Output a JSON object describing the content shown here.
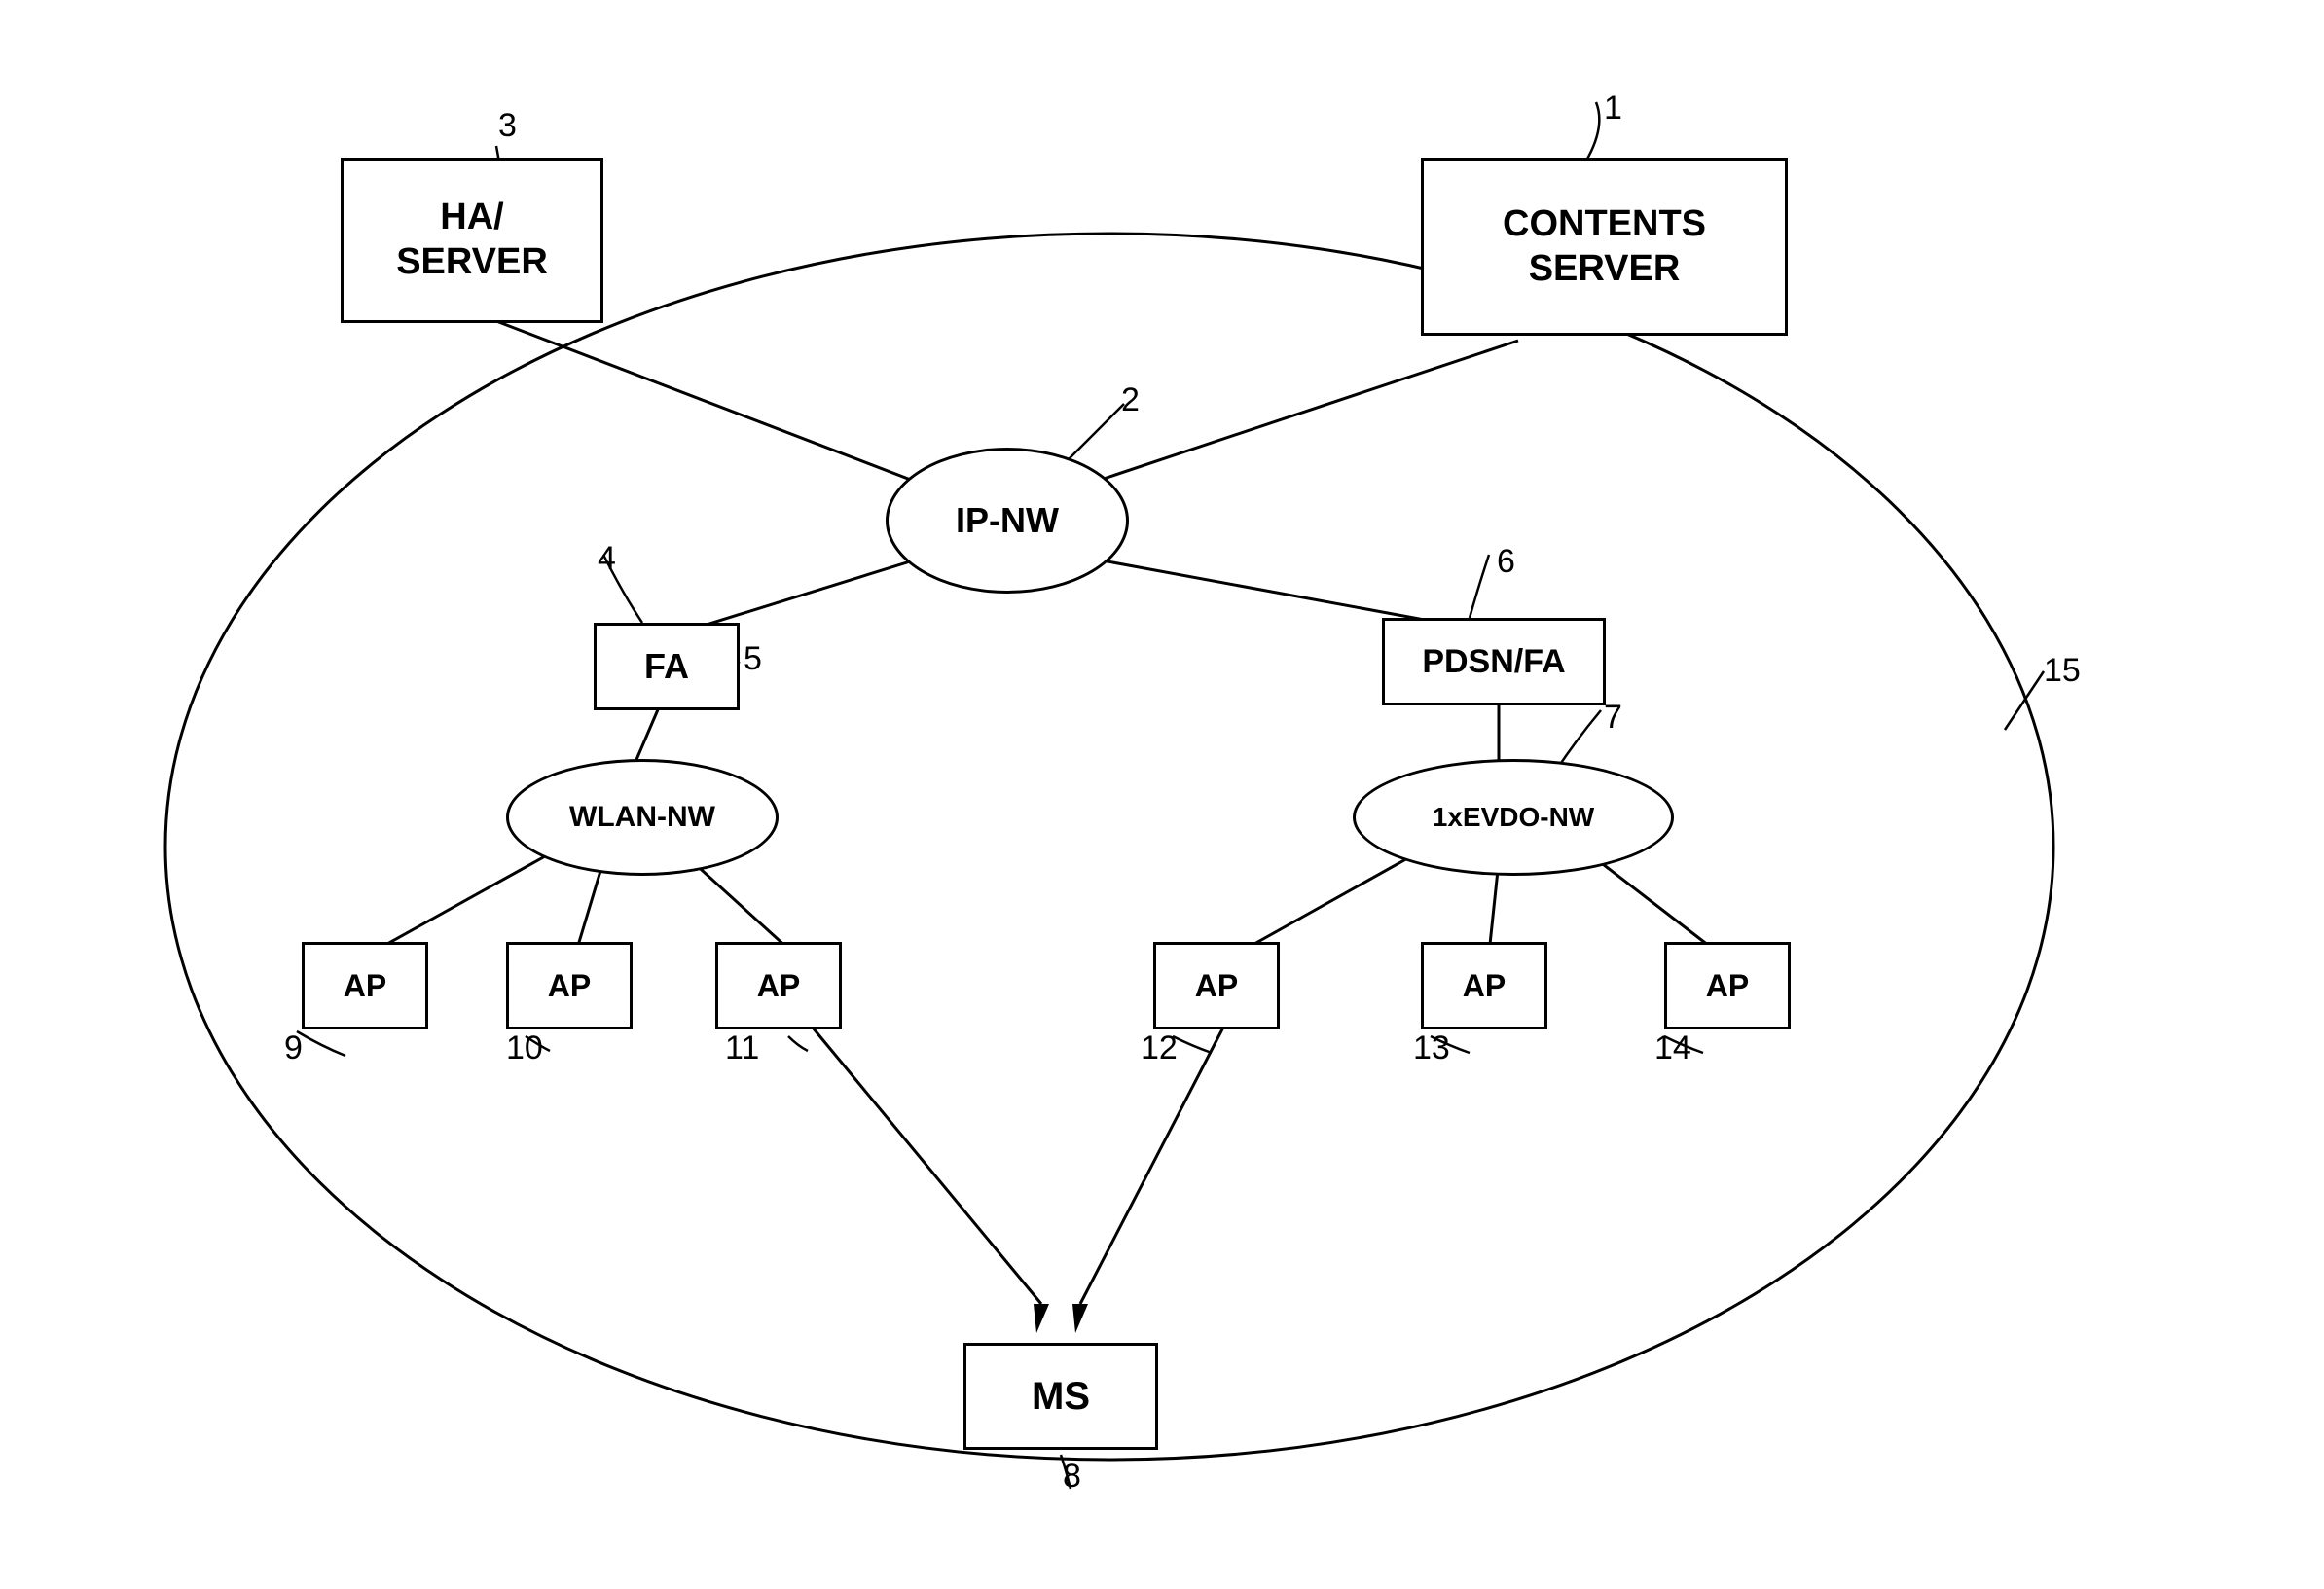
{
  "nodes": {
    "contents_server": {
      "label": "CONTENTS\nSERVER",
      "ref": "1"
    },
    "ip_nw": {
      "label": "IP-NW",
      "ref": "2"
    },
    "ha_server": {
      "label": "HA/\nSERVER",
      "ref": "3"
    },
    "fa": {
      "label": "FA",
      "ref": "4"
    },
    "ref5": {
      "label": "5"
    },
    "pdsn_fa": {
      "label": "PDSN/FA",
      "ref": "6"
    },
    "evdo_nw": {
      "label": "1xEVDO-NW",
      "ref": "7"
    },
    "ms": {
      "label": "MS",
      "ref": "8"
    },
    "wlan_nw": {
      "label": "WLAN-NW",
      "ref": ""
    },
    "ap_wlan_1": {
      "label": "AP",
      "ref": "9"
    },
    "ap_wlan_2": {
      "label": "AP",
      "ref": "10"
    },
    "ap_wlan_3": {
      "label": "AP",
      "ref": "11"
    },
    "ap_evdo_1": {
      "label": "AP",
      "ref": "12"
    },
    "ap_evdo_2": {
      "label": "AP",
      "ref": "13"
    },
    "ap_evdo_3": {
      "label": "AP",
      "ref": "14"
    },
    "large_network": {
      "ref": "15"
    }
  }
}
